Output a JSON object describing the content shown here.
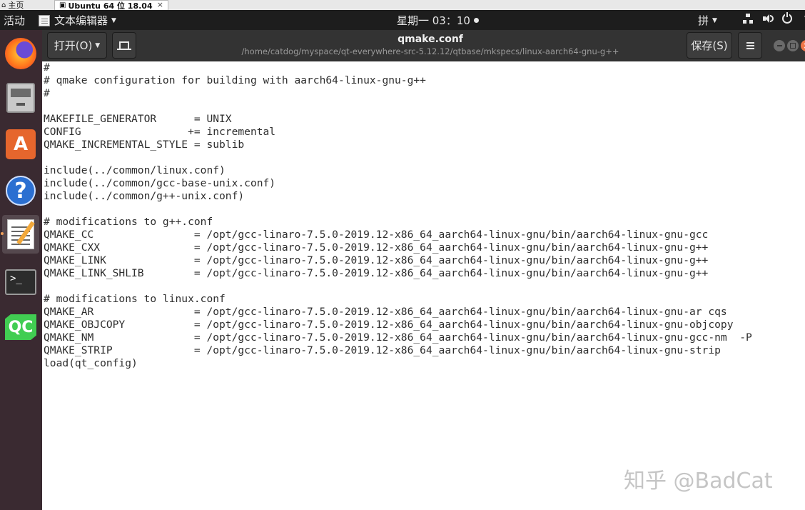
{
  "vm_tabs": {
    "home": {
      "label": "主页",
      "icon": "home-icon"
    },
    "active": {
      "label": "Ubuntu 64 位 18.04",
      "icon": "vm-icon",
      "close": "×"
    }
  },
  "topbar": {
    "activities": "活动",
    "app_menu": "文本编辑器",
    "clock": "星期一 03：10",
    "input_method": "拼",
    "tray_icons": [
      "network-icon",
      "volume-icon",
      "power-icon"
    ]
  },
  "dock": {
    "items": [
      {
        "name": "firefox",
        "icon": "firefox-icon"
      },
      {
        "name": "files",
        "icon": "files-icon"
      },
      {
        "name": "ubuntu-software",
        "icon": "software-center-icon",
        "glyph": "A"
      },
      {
        "name": "help",
        "icon": "help-icon",
        "glyph": "?"
      },
      {
        "name": "text-editor",
        "icon": "text-editor-icon",
        "active": true
      },
      {
        "name": "terminal",
        "icon": "terminal-icon",
        "glyph": ">_"
      },
      {
        "name": "qt-creator",
        "icon": "qt-creator-icon",
        "glyph": "QC"
      }
    ]
  },
  "header": {
    "open_label": "打开(O)",
    "title": "qmake.conf",
    "path": "/home/catdog/myspace/qt-everywhere-src-5.12.12/qtbase/mkspecs/linux-aarch64-gnu-g++",
    "save_label": "保存(S)"
  },
  "document": {
    "lines": [
      "#",
      "# qmake configuration for building with aarch64-linux-gnu-g++",
      "#",
      "",
      "MAKEFILE_GENERATOR      = UNIX",
      "CONFIG                 += incremental",
      "QMAKE_INCREMENTAL_STYLE = sublib",
      "",
      "include(../common/linux.conf)",
      "include(../common/gcc-base-unix.conf)",
      "include(../common/g++-unix.conf)",
      "",
      "# modifications to g++.conf",
      "QMAKE_CC                = /opt/gcc-linaro-7.5.0-2019.12-x86_64_aarch64-linux-gnu/bin/aarch64-linux-gnu-gcc",
      "QMAKE_CXX               = /opt/gcc-linaro-7.5.0-2019.12-x86_64_aarch64-linux-gnu/bin/aarch64-linux-gnu-g++",
      "QMAKE_LINK              = /opt/gcc-linaro-7.5.0-2019.12-x86_64_aarch64-linux-gnu/bin/aarch64-linux-gnu-g++",
      "QMAKE_LINK_SHLIB        = /opt/gcc-linaro-7.5.0-2019.12-x86_64_aarch64-linux-gnu/bin/aarch64-linux-gnu-g++",
      "",
      "# modifications to linux.conf",
      "QMAKE_AR                = /opt/gcc-linaro-7.5.0-2019.12-x86_64_aarch64-linux-gnu/bin/aarch64-linux-gnu-ar cqs",
      "QMAKE_OBJCOPY           = /opt/gcc-linaro-7.5.0-2019.12-x86_64_aarch64-linux-gnu/bin/aarch64-linux-gnu-objcopy",
      "QMAKE_NM                = /opt/gcc-linaro-7.5.0-2019.12-x86_64_aarch64-linux-gnu/bin/aarch64-linux-gnu-gcc-nm  -P",
      "QMAKE_STRIP             = /opt/gcc-linaro-7.5.0-2019.12-x86_64_aarch64-linux-gnu/bin/aarch64-linux-gnu-strip",
      "load(qt_config)"
    ]
  },
  "watermark": "知乎 @BadCat"
}
